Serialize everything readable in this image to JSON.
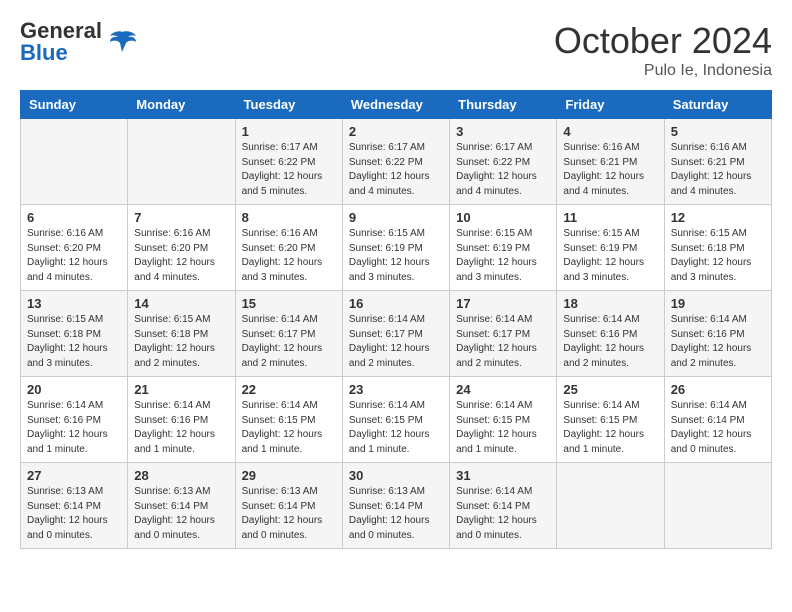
{
  "header": {
    "logo_line1": "General",
    "logo_line2": "Blue",
    "month": "October 2024",
    "location": "Pulo Ie, Indonesia"
  },
  "weekdays": [
    "Sunday",
    "Monday",
    "Tuesday",
    "Wednesday",
    "Thursday",
    "Friday",
    "Saturday"
  ],
  "weeks": [
    [
      {
        "day": "",
        "info": ""
      },
      {
        "day": "",
        "info": ""
      },
      {
        "day": "1",
        "info": "Sunrise: 6:17 AM\nSunset: 6:22 PM\nDaylight: 12 hours\nand 5 minutes."
      },
      {
        "day": "2",
        "info": "Sunrise: 6:17 AM\nSunset: 6:22 PM\nDaylight: 12 hours\nand 4 minutes."
      },
      {
        "day": "3",
        "info": "Sunrise: 6:17 AM\nSunset: 6:22 PM\nDaylight: 12 hours\nand 4 minutes."
      },
      {
        "day": "4",
        "info": "Sunrise: 6:16 AM\nSunset: 6:21 PM\nDaylight: 12 hours\nand 4 minutes."
      },
      {
        "day": "5",
        "info": "Sunrise: 6:16 AM\nSunset: 6:21 PM\nDaylight: 12 hours\nand 4 minutes."
      }
    ],
    [
      {
        "day": "6",
        "info": "Sunrise: 6:16 AM\nSunset: 6:20 PM\nDaylight: 12 hours\nand 4 minutes."
      },
      {
        "day": "7",
        "info": "Sunrise: 6:16 AM\nSunset: 6:20 PM\nDaylight: 12 hours\nand 4 minutes."
      },
      {
        "day": "8",
        "info": "Sunrise: 6:16 AM\nSunset: 6:20 PM\nDaylight: 12 hours\nand 3 minutes."
      },
      {
        "day": "9",
        "info": "Sunrise: 6:15 AM\nSunset: 6:19 PM\nDaylight: 12 hours\nand 3 minutes."
      },
      {
        "day": "10",
        "info": "Sunrise: 6:15 AM\nSunset: 6:19 PM\nDaylight: 12 hours\nand 3 minutes."
      },
      {
        "day": "11",
        "info": "Sunrise: 6:15 AM\nSunset: 6:19 PM\nDaylight: 12 hours\nand 3 minutes."
      },
      {
        "day": "12",
        "info": "Sunrise: 6:15 AM\nSunset: 6:18 PM\nDaylight: 12 hours\nand 3 minutes."
      }
    ],
    [
      {
        "day": "13",
        "info": "Sunrise: 6:15 AM\nSunset: 6:18 PM\nDaylight: 12 hours\nand 3 minutes."
      },
      {
        "day": "14",
        "info": "Sunrise: 6:15 AM\nSunset: 6:18 PM\nDaylight: 12 hours\nand 2 minutes."
      },
      {
        "day": "15",
        "info": "Sunrise: 6:14 AM\nSunset: 6:17 PM\nDaylight: 12 hours\nand 2 minutes."
      },
      {
        "day": "16",
        "info": "Sunrise: 6:14 AM\nSunset: 6:17 PM\nDaylight: 12 hours\nand 2 minutes."
      },
      {
        "day": "17",
        "info": "Sunrise: 6:14 AM\nSunset: 6:17 PM\nDaylight: 12 hours\nand 2 minutes."
      },
      {
        "day": "18",
        "info": "Sunrise: 6:14 AM\nSunset: 6:16 PM\nDaylight: 12 hours\nand 2 minutes."
      },
      {
        "day": "19",
        "info": "Sunrise: 6:14 AM\nSunset: 6:16 PM\nDaylight: 12 hours\nand 2 minutes."
      }
    ],
    [
      {
        "day": "20",
        "info": "Sunrise: 6:14 AM\nSunset: 6:16 PM\nDaylight: 12 hours\nand 1 minute."
      },
      {
        "day": "21",
        "info": "Sunrise: 6:14 AM\nSunset: 6:16 PM\nDaylight: 12 hours\nand 1 minute."
      },
      {
        "day": "22",
        "info": "Sunrise: 6:14 AM\nSunset: 6:15 PM\nDaylight: 12 hours\nand 1 minute."
      },
      {
        "day": "23",
        "info": "Sunrise: 6:14 AM\nSunset: 6:15 PM\nDaylight: 12 hours\nand 1 minute."
      },
      {
        "day": "24",
        "info": "Sunrise: 6:14 AM\nSunset: 6:15 PM\nDaylight: 12 hours\nand 1 minute."
      },
      {
        "day": "25",
        "info": "Sunrise: 6:14 AM\nSunset: 6:15 PM\nDaylight: 12 hours\nand 1 minute."
      },
      {
        "day": "26",
        "info": "Sunrise: 6:14 AM\nSunset: 6:14 PM\nDaylight: 12 hours\nand 0 minutes."
      }
    ],
    [
      {
        "day": "27",
        "info": "Sunrise: 6:13 AM\nSunset: 6:14 PM\nDaylight: 12 hours\nand 0 minutes."
      },
      {
        "day": "28",
        "info": "Sunrise: 6:13 AM\nSunset: 6:14 PM\nDaylight: 12 hours\nand 0 minutes."
      },
      {
        "day": "29",
        "info": "Sunrise: 6:13 AM\nSunset: 6:14 PM\nDaylight: 12 hours\nand 0 minutes."
      },
      {
        "day": "30",
        "info": "Sunrise: 6:13 AM\nSunset: 6:14 PM\nDaylight: 12 hours\nand 0 minutes."
      },
      {
        "day": "31",
        "info": "Sunrise: 6:14 AM\nSunset: 6:14 PM\nDaylight: 12 hours\nand 0 minutes."
      },
      {
        "day": "",
        "info": ""
      },
      {
        "day": "",
        "info": ""
      }
    ]
  ]
}
